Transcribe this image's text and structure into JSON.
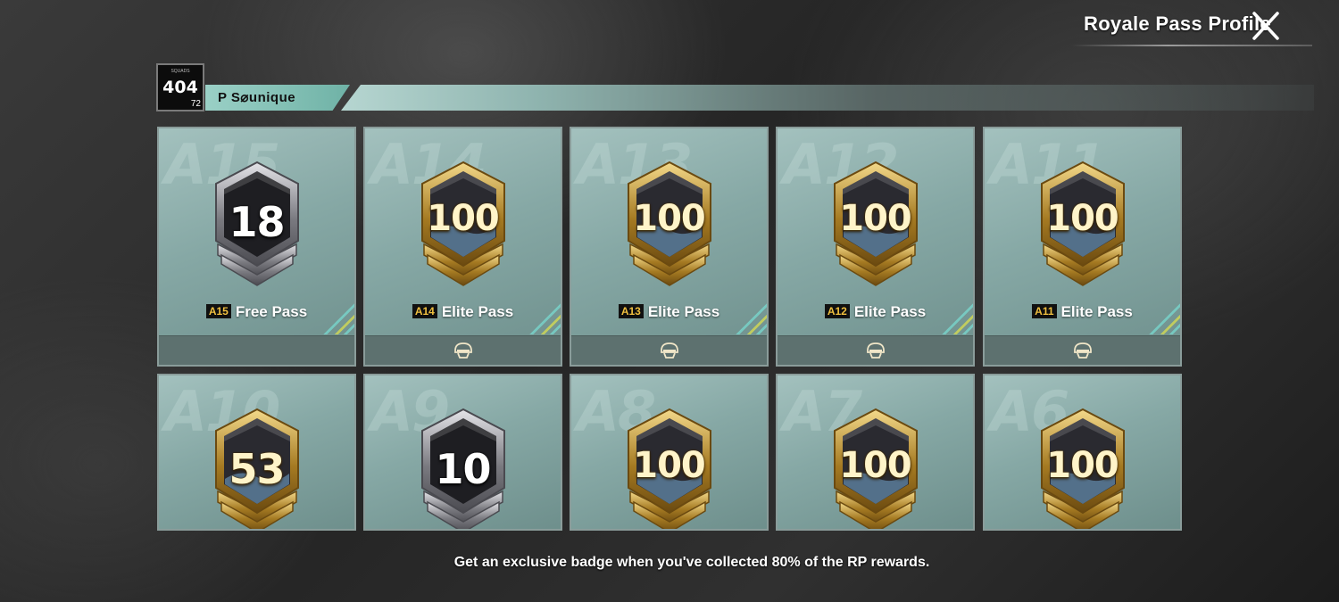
{
  "header": {
    "title": "Royale Pass Profile"
  },
  "profile": {
    "avatar_code": "404",
    "avatar_small_text": "SQUADS",
    "level": "72",
    "name": "P S⌀unique"
  },
  "colors": {
    "panel": "#86a8a5",
    "footer": "#5d716f",
    "gold": "#c9a64a",
    "silver": "#b8b8bc",
    "name_strip": "#9ad0c6"
  },
  "cards": [
    {
      "season": "A15",
      "level": "18",
      "tag": "A15",
      "label": "Free Pass",
      "tier": "silver",
      "has_footer_icon": false
    },
    {
      "season": "A14",
      "level": "100",
      "tag": "A14",
      "label": "Elite Pass",
      "tier": "gold",
      "has_footer_icon": true
    },
    {
      "season": "A13",
      "level": "100",
      "tag": "A13",
      "label": "Elite Pass",
      "tier": "gold",
      "has_footer_icon": true
    },
    {
      "season": "A12",
      "level": "100",
      "tag": "A12",
      "label": "Elite Pass",
      "tier": "gold",
      "has_footer_icon": true
    },
    {
      "season": "A11",
      "level": "100",
      "tag": "A11",
      "label": "Elite Pass",
      "tier": "gold",
      "has_footer_icon": true
    },
    {
      "season": "A10",
      "level": "53",
      "tier": "gold"
    },
    {
      "season": "A9",
      "level": "10",
      "tier": "silver"
    },
    {
      "season": "A8",
      "level": "100",
      "tier": "gold"
    },
    {
      "season": "A7",
      "level": "100",
      "tier": "gold"
    },
    {
      "season": "A6",
      "level": "100",
      "tier": "gold"
    }
  ],
  "footer_hint": "Get an exclusive badge when you've collected 80% of the RP rewards."
}
